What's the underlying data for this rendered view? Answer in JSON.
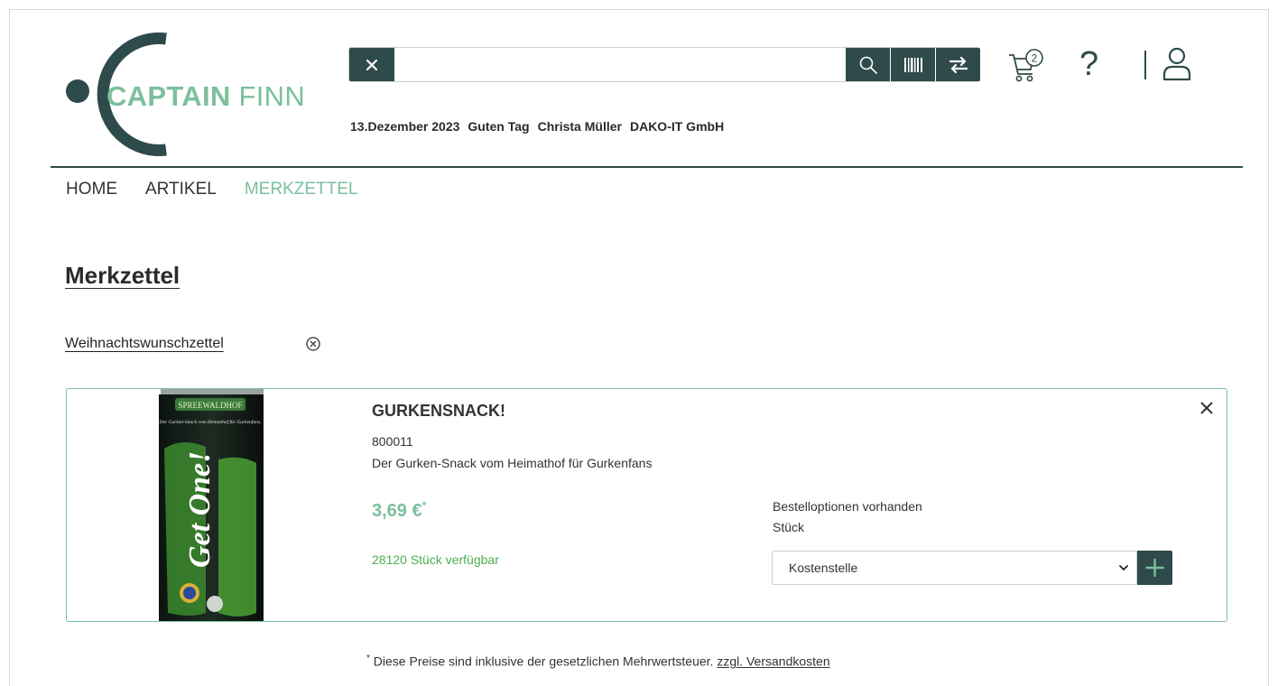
{
  "brand": {
    "bold": "CAPTAIN",
    "light": " FINN",
    "accent": "#7cbf9e",
    "dark": "#2f4a4a"
  },
  "search": {
    "value": "",
    "placeholder": ""
  },
  "header": {
    "date": "13.Dezember 2023",
    "greeting": "Guten Tag",
    "user_name": "Christa Müller",
    "company": "DAKO-IT GmbH",
    "cart_count": "2",
    "help": "?"
  },
  "nav": [
    "HOME",
    "ARTIKEL",
    "MERKZETTEL"
  ],
  "page": {
    "title": "Merkzettel"
  },
  "list": {
    "name": "Weihnachtswunschzettel"
  },
  "product": {
    "name": "GURKENSNACK!",
    "number": "800011",
    "description": "Der Gurken-Snack vom Heimathof für Gurkenfans",
    "price": "3,69 €",
    "price_mark": "*",
    "stock": "28120 Stück verfügbar",
    "options_text": "Bestelloptionen vorhanden",
    "unit": "Stück",
    "cost_center": "Kostenstelle",
    "image_brand": "SPREEWALDHOF",
    "image_tagline": "Der Gurken-Snack vom Heimathof für Gurkenfans.",
    "image_title": "Get One!"
  },
  "footnote": {
    "mark": "*",
    "text": " Diese Preise sind inklusive der gesetzlichen Mehrwertsteuer. ",
    "link": "zzgl. Versandkosten"
  }
}
